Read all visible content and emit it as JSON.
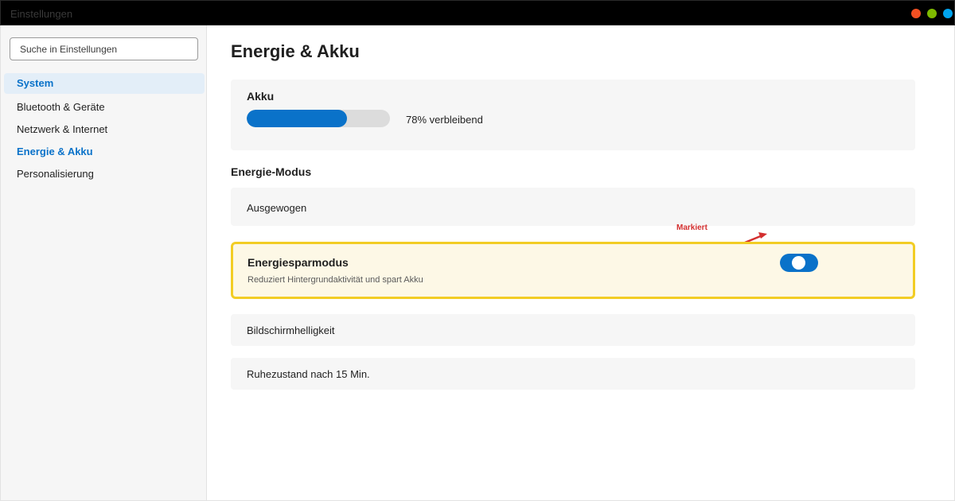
{
  "window": {
    "title": "Einstellungen",
    "controls": [
      {
        "name": "close",
        "color": "#f25022"
      },
      {
        "name": "minimize",
        "color": "#7fba00"
      },
      {
        "name": "maximize",
        "color": "#00a4ef"
      }
    ]
  },
  "sidebar": {
    "search_placeholder": "Suche in Einstellungen",
    "items": [
      {
        "label": "System",
        "state": "selected"
      },
      {
        "label": "Bluetooth & Geräte",
        "state": "normal"
      },
      {
        "label": "Netzwerk & Internet",
        "state": "normal"
      },
      {
        "label": "Energie & Akku",
        "state": "active"
      },
      {
        "label": "Personalisierung",
        "state": "normal"
      }
    ]
  },
  "main": {
    "page_title": "Energie & Akku",
    "battery": {
      "title": "Akku",
      "percent": 70,
      "text": "78% verbleibend",
      "bar_color": "#0a72c9"
    },
    "section_title": "Energie-Modus",
    "mode_value": "Ausgewogen",
    "saver": {
      "title": "Energiesparmodus",
      "description": "Reduziert Hintergrundaktivität und spart Akku",
      "toggle_on": true,
      "toggle_color": "#0a72c9",
      "highlight_color": "#f2cd25"
    },
    "annotation": {
      "label": "Markiert",
      "color": "#d32f2f"
    },
    "brightness_label": "Bildschirmhelligkeit",
    "sleep_label": "Ruhezustand nach 15 Min."
  }
}
